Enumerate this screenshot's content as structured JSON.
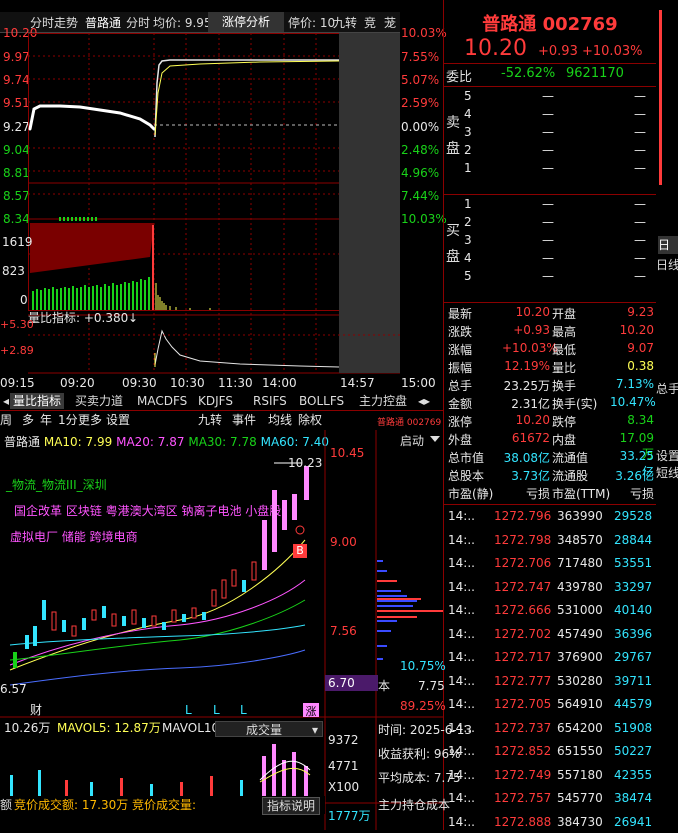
{
  "topbar": {
    "tab1": "分时走势",
    "tab2": "普路通",
    "tab3": "分时",
    "avg": "均价: 9.95",
    "zt_btn": "涨停分析",
    "limit": "停价: 10",
    "jiuzhuan": "九转",
    "jing": "竞",
    "long": "茏"
  },
  "price_axis": [
    "10.20",
    "9.97",
    "9.74",
    "9.51",
    "9.27",
    "9.04",
    "8.81",
    "8.57",
    "8.34"
  ],
  "pct_axis": [
    "10.03%",
    "7.55%",
    "5.07%",
    "2.59%",
    "0.00%",
    "2.48%",
    "4.96%",
    "7.44%",
    "10.03%"
  ],
  "vol_axis": [
    "1619",
    "823",
    "0"
  ],
  "liangbi": {
    "label": "量比指标: +0.380",
    "arrow": "↓",
    "y1": "+5.30",
    "y2": "+2.89"
  },
  "time_axis": [
    "09:15",
    "09:20",
    "09:30",
    "10:30",
    "11:30",
    "14:00",
    "14:57",
    "15:00"
  ],
  "stock": {
    "name": "普路通",
    "code": "002769",
    "price": "10.20",
    "change": "+0.93",
    "pct": "+10.03%"
  },
  "weibi": {
    "label": "委比",
    "pct": "-52.62%",
    "vol": "9621170"
  },
  "sell_label": [
    "卖",
    "盘"
  ],
  "buy_label": [
    "买",
    "盘"
  ],
  "sell_rows": [
    {
      "lvl": "5",
      "price": "—",
      "vol": "—"
    },
    {
      "lvl": "4",
      "price": "—",
      "vol": "—"
    },
    {
      "lvl": "3",
      "price": "—",
      "vol": "—"
    },
    {
      "lvl": "2",
      "price": "—",
      "vol": "—"
    },
    {
      "lvl": "1",
      "price": "—",
      "vol": "—"
    }
  ],
  "buy_rows": [
    {
      "lvl": "1",
      "price": "—",
      "vol": "—"
    },
    {
      "lvl": "2",
      "price": "—",
      "vol": "—"
    },
    {
      "lvl": "3",
      "price": "—",
      "vol": "—"
    },
    {
      "lvl": "4",
      "price": "—",
      "vol": "—"
    },
    {
      "lvl": "5",
      "price": "—",
      "vol": "—"
    }
  ],
  "quote_rows": [
    {
      "l1": "最新",
      "v1": "10.20",
      "l2": "开盘",
      "v2": "9.23"
    },
    {
      "l1": "涨跌",
      "v1": "+0.93",
      "l2": "最高",
      "v2": "10.20"
    },
    {
      "l1": "涨幅",
      "v1": "+10.03%",
      "l2": "最低",
      "v2": "9.07"
    },
    {
      "l1": "振幅",
      "v1": "12.19%",
      "l2": "量比",
      "v2": "0.38"
    },
    {
      "l1": "总手",
      "v1": "23.25万",
      "l2": "换手",
      "v2": "7.13%"
    },
    {
      "l1": "金额",
      "v1": "2.31亿",
      "l2": "换手(实)",
      "v2": "10.47%"
    },
    {
      "l1": "涨停",
      "v1": "10.20",
      "l2": "跌停",
      "v2": "8.34"
    },
    {
      "l1": "外盘",
      "v1": "61672",
      "l2": "内盘",
      "v2": "17.09万"
    },
    {
      "l1": "总市值",
      "v1": "38.08亿",
      "l2": "流通值",
      "v2": "33.25亿"
    },
    {
      "l1": "总股本",
      "v1": "3.73亿",
      "l2": "流通股",
      "v2": "3.26亿"
    },
    {
      "l1": "市盈(静)",
      "v1": "亏损",
      "l2": "市盈(TTM)",
      "v2": "亏损"
    }
  ],
  "ticks": [
    {
      "t": "14:..",
      "p": "1272.796",
      "v": "363990",
      "n": "29528"
    },
    {
      "t": "14:..",
      "p": "1272.798",
      "v": "348570",
      "n": "28844"
    },
    {
      "t": "14:..",
      "p": "1272.706",
      "v": "717480",
      "n": "53551"
    },
    {
      "t": "14:..",
      "p": "1272.747",
      "v": "439780",
      "n": "33297"
    },
    {
      "t": "14:..",
      "p": "1272.666",
      "v": "531000",
      "n": "40140"
    },
    {
      "t": "14:..",
      "p": "1272.702",
      "v": "457490",
      "n": "36396"
    },
    {
      "t": "14:..",
      "p": "1272.717",
      "v": "376900",
      "n": "29767"
    },
    {
      "t": "14:..",
      "p": "1272.777",
      "v": "530280",
      "n": "39711"
    },
    {
      "t": "14:..",
      "p": "1272.705",
      "v": "564910",
      "n": "44579"
    },
    {
      "t": "14:..",
      "p": "1272.737",
      "v": "654200",
      "n": "51908"
    },
    {
      "t": "14:..",
      "p": "1272.852",
      "v": "651550",
      "n": "50227"
    },
    {
      "t": "14:..",
      "p": "1272.749",
      "v": "557180",
      "n": "42355"
    },
    {
      "t": "14:..",
      "p": "1272.757",
      "v": "545770",
      "n": "38474"
    },
    {
      "t": "14:..",
      "p": "1272.888",
      "v": "384730",
      "n": "26941"
    }
  ],
  "tabs": [
    "量比指标",
    "买卖力道",
    "MACDFS",
    "KDJFS",
    "RSIFS",
    "BOLLFS",
    "主力控盘"
  ],
  "kline_menu": [
    "周",
    "多",
    "年",
    "1分",
    "更多",
    "设置",
    "九转",
    "事件",
    "均线",
    "除权"
  ],
  "ma": {
    "name": "普路通",
    "ma10": "MA10: 7.99",
    "ma20": "MA20: 7.87",
    "ma30": "MA30: 7.78",
    "ma60": "MA60: 7.40"
  },
  "tags_line1": "_物流_物流III_深圳",
  "tags_line2": "国企改革  区块链  粤港澳大湾区  钠离子电池  小盘股",
  "tags_line3": "虚拟电厂  储能  跨境电商",
  "kline_axis": [
    "10.45",
    "9.00",
    "7.56",
    "6.57"
  ],
  "kline_high": "10.23",
  "kline_b": "B",
  "cyq": {
    "title": "普路通 002769",
    "qa": "启动",
    "pct1": "10.75%",
    "cost_lbl": "本",
    "cost": "7.75",
    "pct2": "89.25%",
    "price_box": "6.70"
  },
  "kline_markers": [
    "财",
    "L",
    "L",
    "L",
    "涨"
  ],
  "vol_bar": {
    "v1": "10.26万",
    "mavol5": "MAVOL5: 12.87万",
    "mavol10": "MAVOL10:",
    "sel": "成交量",
    "y1": "9372",
    "y2": "4771",
    "x100": "X100"
  },
  "bottom": {
    "l1": "额",
    "l2": "竞价成交额: 17.30万",
    "l3": "竞价成交量:",
    "btn": "指标说明",
    "amt": "1777万"
  },
  "cyq_info": {
    "date": "时间: 2025-6-13",
    "profit": "收益获利: 96%",
    "avgcost": "平均成本: 7.75",
    "hold": "主力持仓成本"
  },
  "side": {
    "a": "日",
    "b": "日线",
    "c": "总手",
    "d": "设置",
    "e": "短线"
  }
}
